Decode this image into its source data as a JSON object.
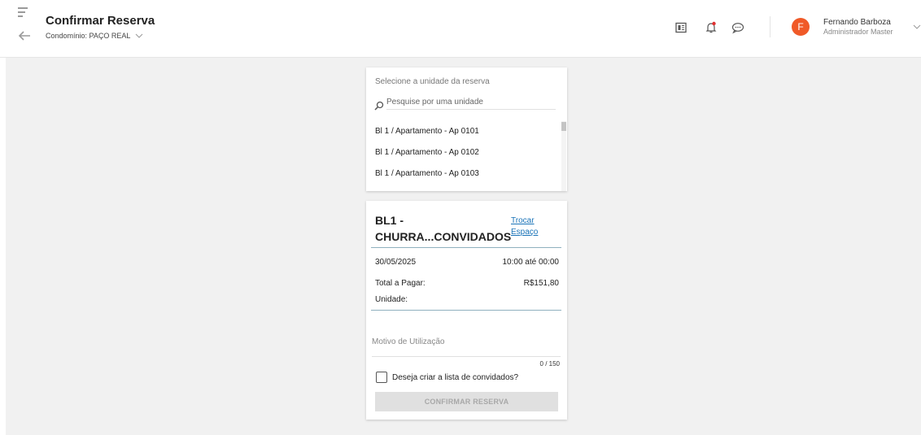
{
  "header": {
    "title": "Confirmar Reserva",
    "condo_label": "Condomínio: PAÇO REAL",
    "icons": [
      "menu-icon",
      "back-icon",
      "newspaper-icon",
      "bell-icon",
      "chat-icon"
    ],
    "user": {
      "initial": "F",
      "name": "Fernando Barboza",
      "role": "Administrador Master",
      "avatar_color": "#f05a28"
    }
  },
  "unit_selector": {
    "label": "Selecione a unidade da reserva",
    "search_placeholder": "Pesquise por uma unidade",
    "search_value": "",
    "units": [
      "Bl 1 / Apartamento - Ap 0101",
      "Bl 1 / Apartamento - Ap 0102",
      "Bl 1 / Apartamento - Ap 0103"
    ]
  },
  "reservation": {
    "space_name": "BL1 - CHURRA...CONVIDADOS",
    "change_space_link": "Trocar Espaço",
    "date": "30/05/2025",
    "time": "10:00 até 00:00",
    "total_label": "Total a Pagar:",
    "total_value": "R$151,80",
    "unit_label": "Unidade:",
    "unit_value": "",
    "reason_placeholder": "Motivo de Utilização",
    "reason_value": "",
    "reason_counter": "0 / 150",
    "guest_list_label": "Deseja criar a lista de convidados?",
    "guest_list_checked": false,
    "confirm_button": "CONFIRMAR RESERVA",
    "link_color": "#1a73b8"
  }
}
